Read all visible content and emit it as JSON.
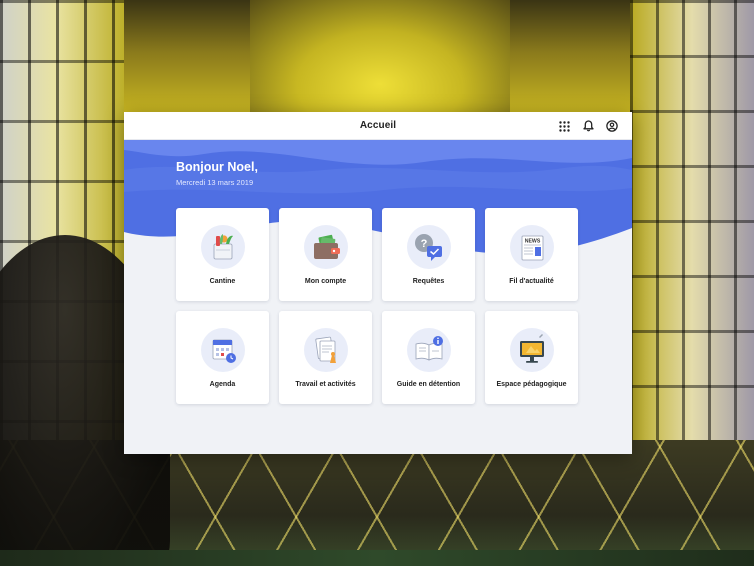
{
  "header": {
    "title": "Accueil",
    "icons": [
      "apps-grid-icon",
      "bell-icon",
      "account-icon"
    ]
  },
  "greeting": {
    "title": "Bonjour Noel,",
    "date": "Mercredi 13 mars 2019"
  },
  "tiles": [
    {
      "label": "Cantine",
      "icon": "food-basket-icon"
    },
    {
      "label": "Mon compte",
      "icon": "wallet-icon"
    },
    {
      "label": "Requêtes",
      "icon": "question-chat-icon"
    },
    {
      "label": "Fil d'actualité",
      "icon": "newspaper-icon"
    },
    {
      "label": "Agenda",
      "icon": "calendar-icon"
    },
    {
      "label": "Travail et activités",
      "icon": "documents-icon"
    },
    {
      "label": "Guide en détention",
      "icon": "book-info-icon"
    },
    {
      "label": "Espace pédagogique",
      "icon": "monitor-icon"
    }
  ],
  "colors": {
    "hero_blue": "#4f6fe3",
    "hero_wave_light": "#6f8cf0",
    "tile_bg": "#ffffff",
    "page_bg": "#f0f2f6"
  }
}
